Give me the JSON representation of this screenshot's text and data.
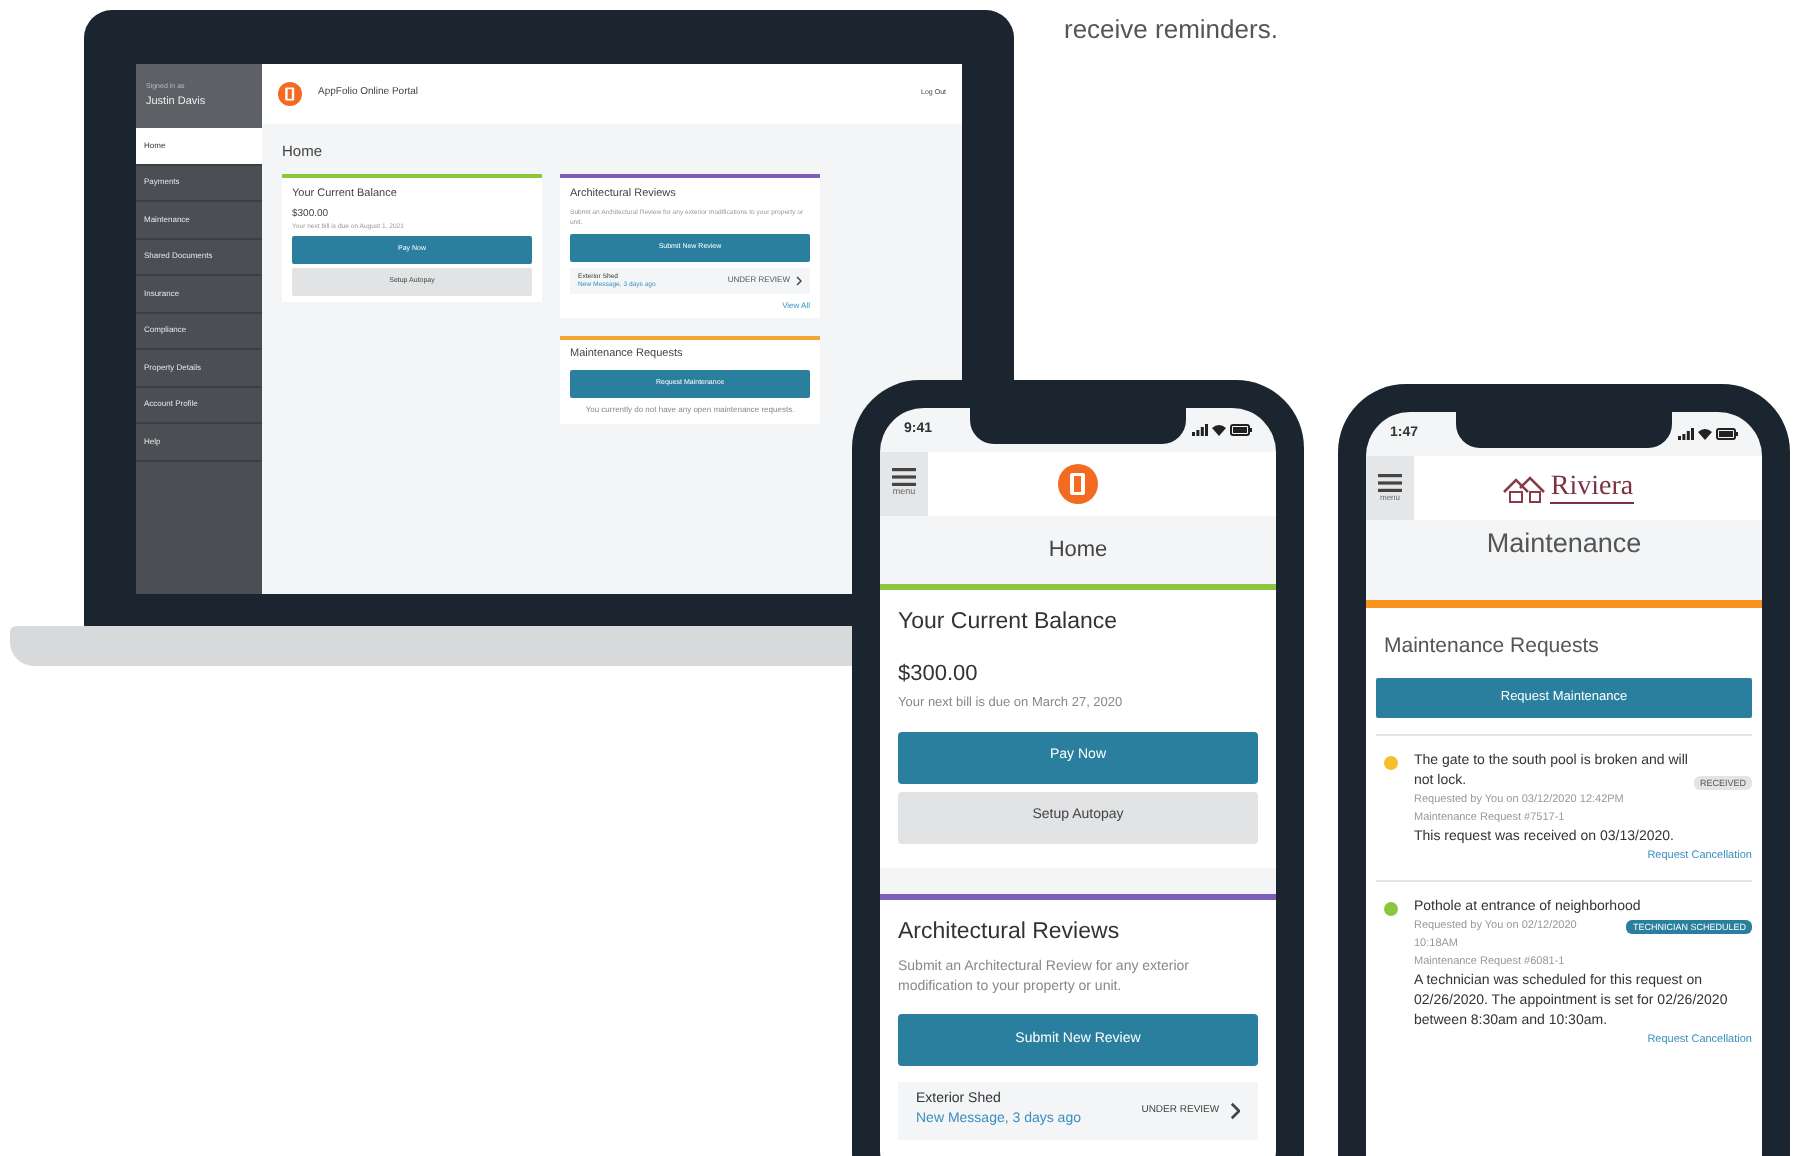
{
  "intro_text": "receive reminders.",
  "laptop": {
    "sidebar": {
      "caption": "Signed in as",
      "user": "Justin Davis",
      "items": [
        {
          "label": "Home",
          "selected": true
        },
        {
          "label": "Payments",
          "selected": false
        },
        {
          "label": "Maintenance",
          "selected": false
        },
        {
          "label": "Shared Documents",
          "selected": false
        },
        {
          "label": "Insurance",
          "selected": false
        },
        {
          "label": "Compliance",
          "selected": false
        },
        {
          "label": "Property Details",
          "selected": false
        },
        {
          "label": "Account Profile",
          "selected": false
        },
        {
          "label": "Help",
          "selected": false
        }
      ]
    },
    "header": {
      "title": "AppFolio Online Portal",
      "logout": "Log Out"
    },
    "page_title": "Home",
    "balance_card": {
      "title": "Your Current Balance",
      "amount": "$300.00",
      "due": "Your next bill is due on August 1, 2021",
      "pay_button": "Pay Now",
      "autopay_button": "Setup Autopay"
    },
    "reviews_card": {
      "title": "Architectural Reviews",
      "description": "Submit an Architectural Review for any exterior modifications to your property or unit.",
      "button": "Submit New Review",
      "item": {
        "title": "Exterior Shed",
        "message": "New Message, 3 days ago",
        "status": "UNDER REVIEW"
      },
      "view_all": "View All"
    },
    "maintenance_card": {
      "title": "Maintenance Requests",
      "button": "Request Maintenance",
      "empty_text": "You currently do not have any open maintenance requests."
    }
  },
  "phone_home": {
    "time": "9:41",
    "menu_label": "menu",
    "page_title": "Home",
    "balance_card": {
      "title": "Your Current Balance",
      "amount": "$300.00",
      "due": "Your next bill is due on March 27, 2020",
      "pay_button": "Pay Now",
      "autopay_button": "Setup Autopay"
    },
    "reviews_card": {
      "title": "Architectural Reviews",
      "description": "Submit an Architectural Review for any exterior modification to your property or unit.",
      "button": "Submit New Review",
      "item": {
        "title": "Exterior Shed",
        "message": "New Message, 3 days ago",
        "status": "UNDER REVIEW"
      }
    }
  },
  "phone_maintenance": {
    "time": "1:47",
    "menu_label": "menu",
    "brand": "Riviera",
    "page_title": "Maintenance",
    "section_title": "Maintenance Requests",
    "button": "Request Maintenance",
    "requests": [
      {
        "title": "The gate to the south pool is broken and will not lock.",
        "status": "RECEIVED",
        "kind": "received",
        "color": "#f5c02c",
        "requested": "Requested by You on 03/12/2020 12:42PM",
        "number": "Maintenance Request #7517-1",
        "note": "This request was received on 03/13/2020.",
        "link": "Request Cancellation"
      },
      {
        "title": "Pothole at entrance of neighborhood",
        "status": "TECHNICIAN SCHEDULED",
        "kind": "scheduled",
        "color": "#8cc63f",
        "requested": "Requested by You on 02/12/2020 10:18AM",
        "number": "Maintenance Request #6081-1",
        "note": "A technician was scheduled for this request on 02/26/2020. The appointment is set for 02/26/2020 between 8:30am and 10:30am.",
        "link": "Request Cancellation"
      }
    ]
  }
}
